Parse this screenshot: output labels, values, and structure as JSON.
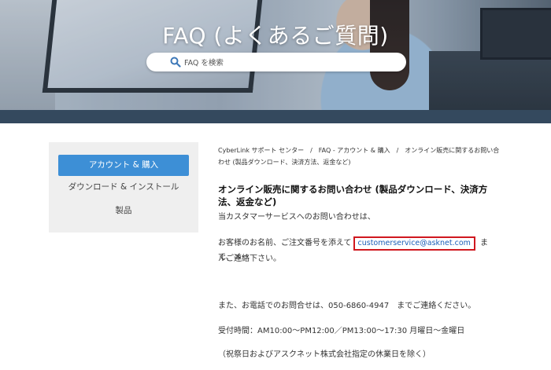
{
  "hero": {
    "title": "FAQ (よくあるご質問)",
    "search_placeholder": "FAQ を検索"
  },
  "sidebar": {
    "items": [
      {
        "label": "アカウント & 購入",
        "active": true
      },
      {
        "label": "ダウンロード & インストール",
        "active": false
      },
      {
        "label": "製品",
        "active": false
      }
    ]
  },
  "breadcrumb": {
    "items": [
      "CyberLink サポート センター",
      "FAQ - アカウント & 購入",
      "オンライン販売に関するお問い合わせ (製品ダウンロード、決済方法、返金など)"
    ]
  },
  "article": {
    "title": "オンライン販売に関するお問い合わせ (製品ダウンロード、決済方法、返金など)",
    "intro": "当カスタマーサービスへのお問い合わせは、",
    "line2_before": "お客様のお名前、ご注文番号を添えて",
    "email": "customerservice@asknet.com",
    "line2_after": "まで、メー",
    "line3": "ルご連絡下さい。",
    "phone_line": "また、お電話でのお問合せは、050-6860-4947　までご連絡ください。",
    "hours_line": "受付時間：AM10:00～PM12:00／PM13:00～17:30 月曜日～金曜日",
    "holiday_line": "（祝祭日およびアスクネット株式会社指定の休業日を除く）"
  },
  "colors": {
    "accent": "#3d8fd6",
    "strip": "#34495e",
    "highlight_border": "#d0181f",
    "link": "#1c5fb8"
  }
}
